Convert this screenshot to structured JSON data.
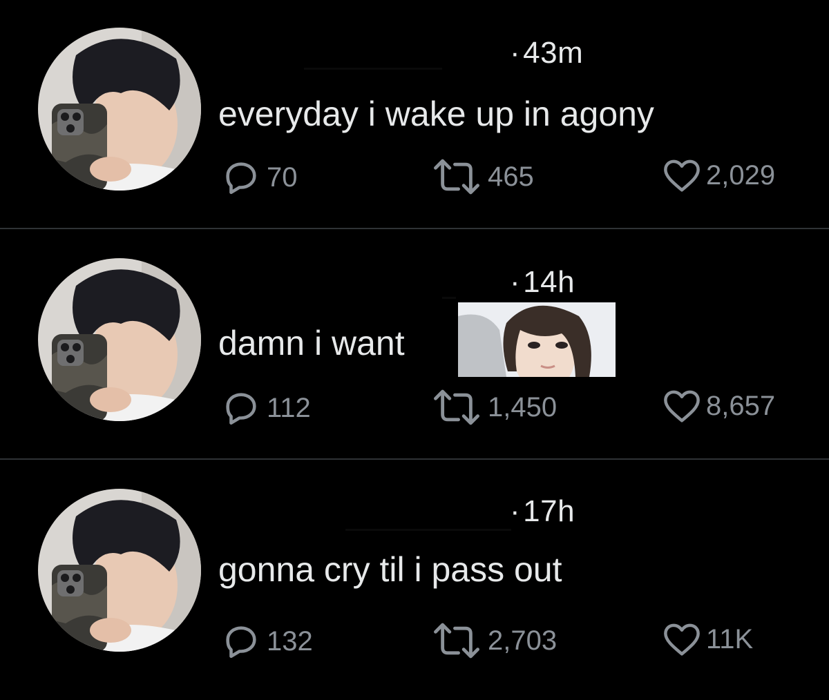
{
  "colors": {
    "background": "#000000",
    "text": "#e7e9ea",
    "muted": "#8b9198",
    "divider": "#2f3336"
  },
  "tweets": [
    {
      "time": "43m",
      "text": "everyday i wake up in agony",
      "replies": "70",
      "retweets": "465",
      "likes": "2,029"
    },
    {
      "time": "14h",
      "text": "damn i want",
      "replies": "112",
      "retweets": "1,450",
      "likes": "8,657"
    },
    {
      "time": "17h",
      "text": "gonna cry til i pass out",
      "replies": "132",
      "retweets": "2,703",
      "likes": "11K"
    }
  ],
  "icons": {
    "reply": "reply-icon",
    "retweet": "retweet-icon",
    "like": "heart-icon"
  }
}
